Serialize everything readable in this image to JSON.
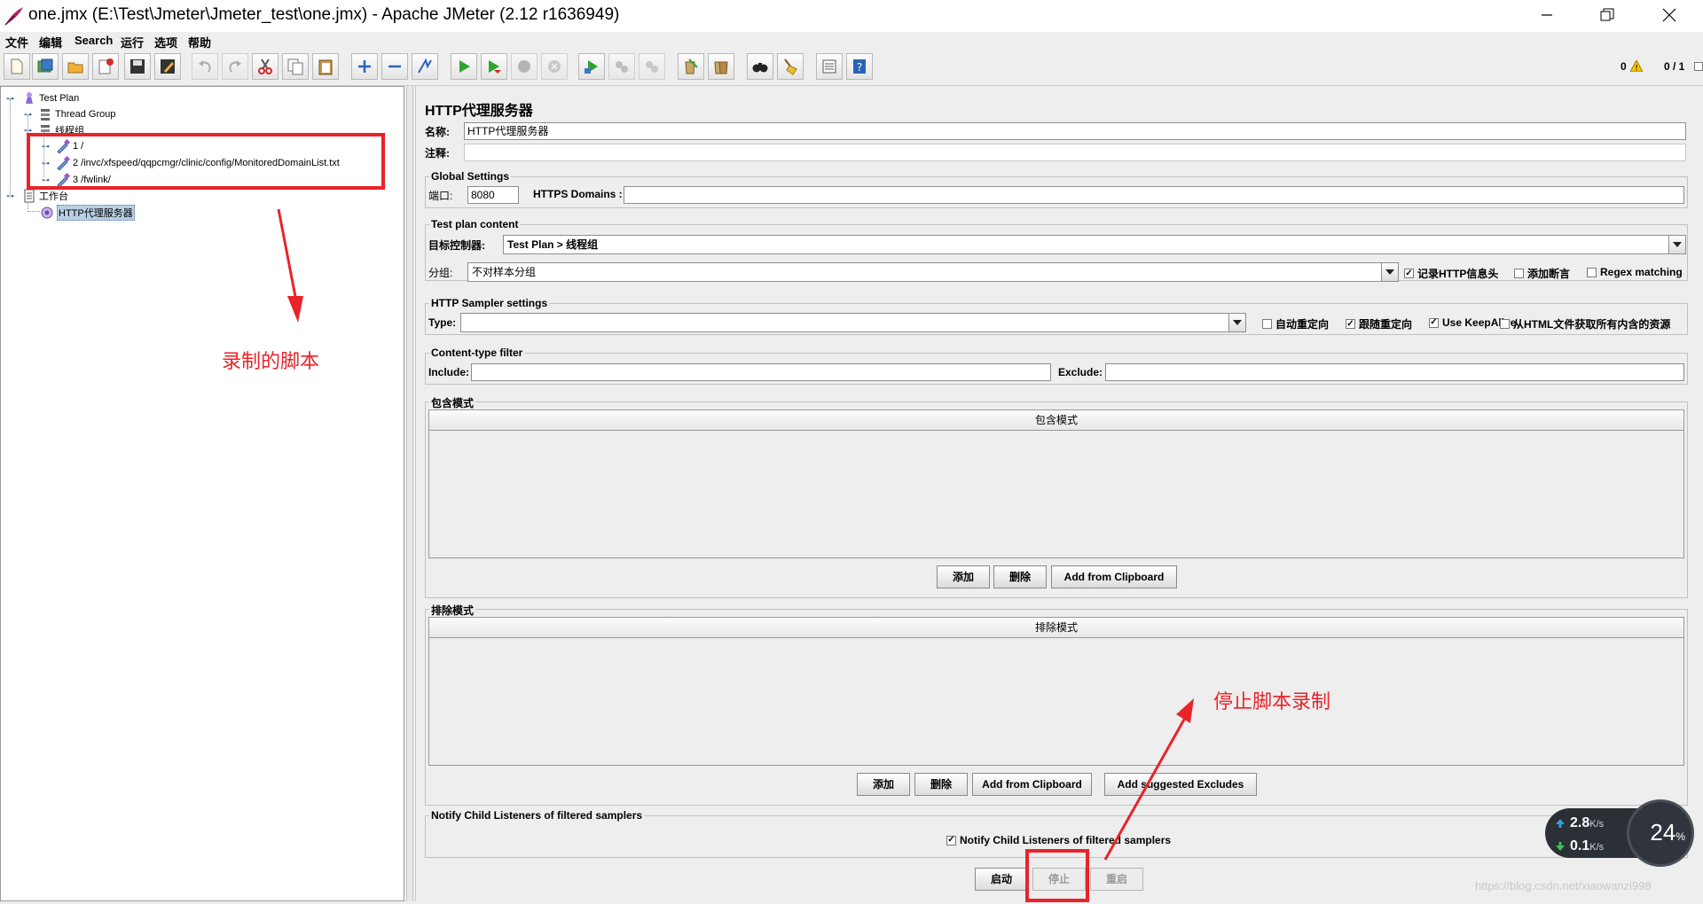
{
  "window": {
    "title": "one.jmx (E:\\Test\\Jmeter\\Jmeter_test\\one.jmx) - Apache JMeter (2.12 r1636949)"
  },
  "menu": {
    "items": [
      "文件",
      "编辑",
      "Search",
      "运行",
      "选项",
      "帮助"
    ]
  },
  "toolbar": {
    "buttons": [
      {
        "icon": "new-icon"
      },
      {
        "icon": "templates-icon"
      },
      {
        "icon": "open-icon"
      },
      {
        "icon": "close-icon"
      },
      {
        "icon": "save-icon"
      },
      {
        "icon": "save-as-icon"
      },
      {
        "icon": "undo-icon"
      },
      {
        "icon": "redo-icon"
      },
      {
        "icon": "cut-icon"
      },
      {
        "icon": "copy-icon"
      },
      {
        "icon": "paste-icon"
      },
      {
        "icon": "expand-icon"
      },
      {
        "icon": "collapse-icon"
      },
      {
        "icon": "toggle-icon"
      },
      {
        "icon": "start-icon"
      },
      {
        "icon": "start-no-pause-icon"
      },
      {
        "icon": "stop-icon"
      },
      {
        "icon": "shutdown-icon"
      },
      {
        "icon": "remote-start-icon"
      },
      {
        "icon": "remote-stop-icon"
      },
      {
        "icon": "remote-shutdown-icon"
      },
      {
        "icon": "clear-icon"
      },
      {
        "icon": "clear-all-icon"
      },
      {
        "icon": "search-icon"
      },
      {
        "icon": "reset-search-icon"
      },
      {
        "icon": "function-helper-icon"
      },
      {
        "icon": "help-icon"
      }
    ],
    "warnings": "0",
    "threads": "0 / 1"
  },
  "tree": {
    "test_plan": "Test Plan",
    "thread_group": "Thread Group",
    "thread_group2": "线程组",
    "samplers": [
      "1 /",
      "2 /invc/xfspeed/qqpcmgr/clinic/config/MonitoredDomainList.txt",
      "3 /fwlink/"
    ],
    "workbench": "工作台",
    "proxy": "HTTP代理服务器"
  },
  "panel": {
    "heading": "HTTP代理服务器",
    "name_label": "名称:",
    "name_value": "HTTP代理服务器",
    "comment_label": "注释:",
    "comment_value": "",
    "global_settings": {
      "title": "Global Settings",
      "port_label": "端口:",
      "port_value": "8080",
      "https_label": "HTTPS Domains :",
      "https_value": ""
    },
    "test_plan_content": {
      "title": "Test plan content",
      "target_label": "目标控制器:",
      "target_value": "Test Plan > 线程组",
      "group_label": "分组:",
      "group_value": "不对样本分组",
      "record_headers": "记录HTTP信息头",
      "record_headers_checked": true,
      "add_assertions": "添加断言",
      "add_assertions_checked": false,
      "regex_matching": "Regex matching",
      "regex_matching_checked": false
    },
    "http_sampler": {
      "title": "HTTP Sampler settings",
      "type_label": "Type:",
      "type_value": "",
      "auto_redirect": "自动重定向",
      "auto_redirect_checked": false,
      "follow_redirect": "跟随重定向",
      "follow_redirect_checked": true,
      "keepalive": "Use KeepAlive",
      "keepalive_checked": true,
      "embedded": "从HTML文件获取所有内含的资源",
      "embedded_checked": false
    },
    "content_type": {
      "title": "Content-type filter",
      "include_label": "Include:",
      "include_value": "",
      "exclude_label": "Exclude:",
      "exclude_value": ""
    },
    "include_patterns": {
      "title": "包含模式",
      "column": "包含模式",
      "add": "添加",
      "delete": "删除",
      "clipboard": "Add from Clipboard"
    },
    "exclude_patterns": {
      "title": "排除模式",
      "column": "排除模式",
      "add": "添加",
      "delete": "删除",
      "clipboard": "Add from Clipboard",
      "suggested": "Add suggested Excludes"
    },
    "notify": {
      "title": "Notify Child Listeners of filtered samplers",
      "checkbox": "Notify Child Listeners of filtered samplers",
      "checked": true
    },
    "actions": {
      "start": "启动",
      "stop": "停止",
      "restart": "重启"
    }
  },
  "annotations": {
    "recorded": "录制的脚本",
    "stop_recording": "停止脚本录制"
  },
  "net_widget": {
    "upload": "2.8",
    "download": "0.1",
    "unit": "K/s",
    "cpu": "24",
    "pct_sign": "%"
  },
  "watermark": "https://blog.csdn.net/xiaowanzi998"
}
